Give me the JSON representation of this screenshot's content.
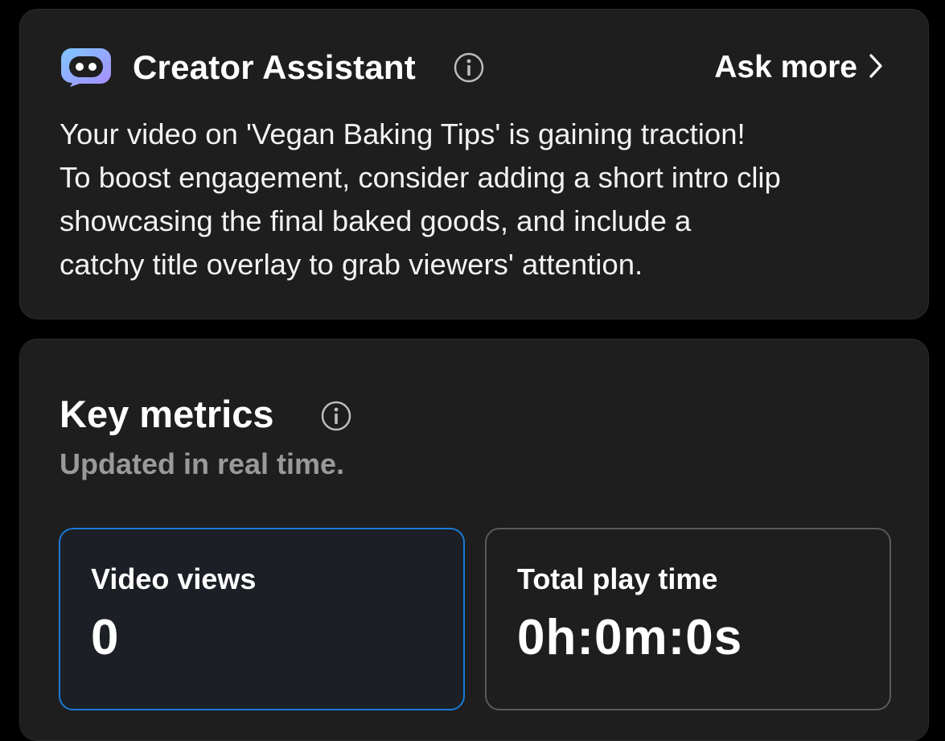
{
  "assistant": {
    "title": "Creator Assistant",
    "info_icon": "info-icon",
    "logo_icon": "robot-face-icon",
    "ask_more_label": "Ask more",
    "ask_more_icon": "chevron-right-icon",
    "message_lines": [
      "Your video on 'Vegan Baking Tips' is gaining traction!",
      "To boost engagement, consider adding a short intro clip",
      "showcasing the final baked goods, and include a",
      "catchy title overlay to grab viewers' attention."
    ]
  },
  "metrics": {
    "title": "Key metrics",
    "info_icon": "info-icon",
    "subtitle": "Updated in real time.",
    "tiles": [
      {
        "label": "Video views",
        "value": "0",
        "selected": true
      },
      {
        "label": "Total play time",
        "value": "0h:0m:0s",
        "selected": false
      }
    ]
  },
  "colors": {
    "background": "#000000",
    "card": "#1e1e1e",
    "selected_border": "#1a7ad4",
    "muted_text": "#9a9a9a",
    "logo_gradient_start": "#7ec8ff",
    "logo_gradient_end": "#a98bff"
  }
}
